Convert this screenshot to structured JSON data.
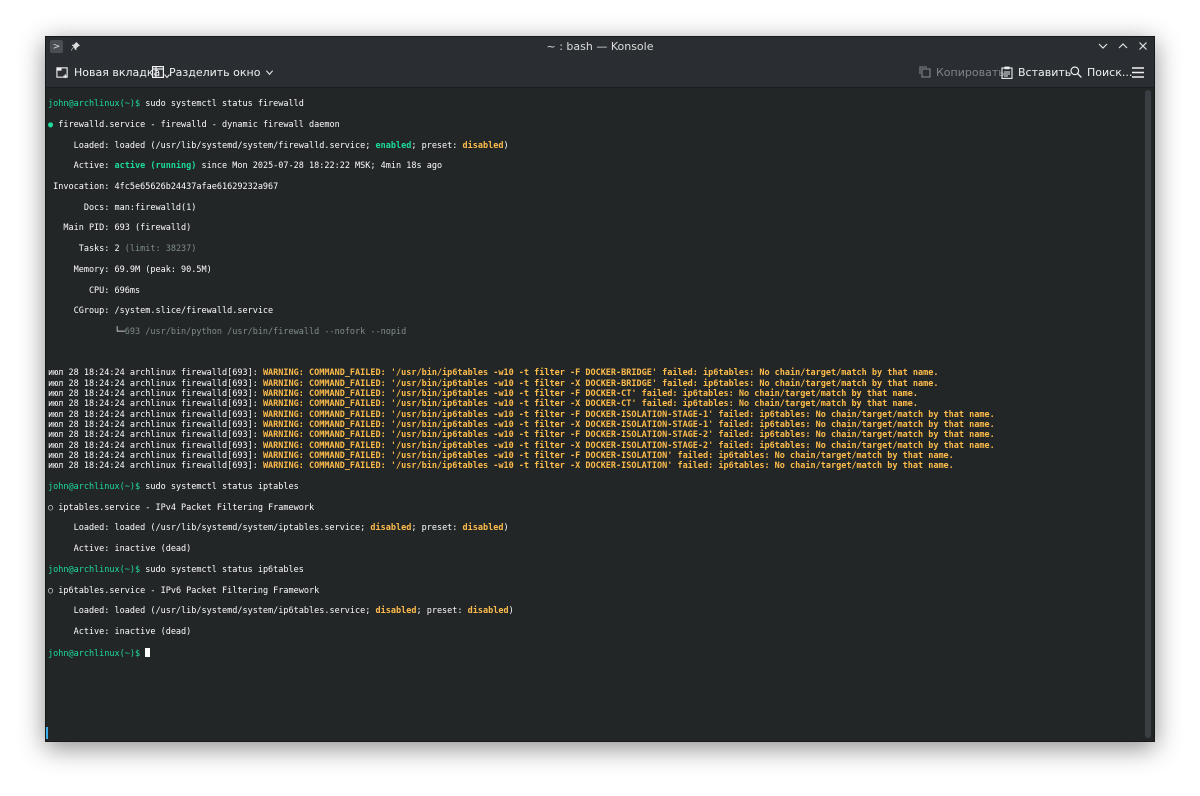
{
  "window": {
    "title": "~ : bash — Konsole"
  },
  "toolbar": {
    "new_tab": "Новая вкладка",
    "split_view": "Разделить окно",
    "copy": "Копировать",
    "paste": "Вставить",
    "search": "Поиск..."
  },
  "colors": {
    "background": "#232627",
    "prompt_green": "#1cdc9a",
    "warning_yellow": "#fdbc4b",
    "dim_gray": "#7f8c8d"
  },
  "terminal": {
    "prompt": "john@archlinux(~)$",
    "cmd1": " sudo systemctl status firewalld",
    "fw_bullet": "●",
    "fw_header": " firewalld.service - firewalld - dynamic firewall daemon",
    "fw_loaded_a": "     Loaded: loaded (/usr/lib/systemd/system/firewalld.service; ",
    "fw_loaded_enabled": "enabled",
    "fw_loaded_b": "; preset: ",
    "fw_loaded_preset": "disabled",
    "fw_loaded_c": ")",
    "fw_active_a": "     Active: ",
    "fw_active_state": "active (running)",
    "fw_active_b": " since Mon 2025-07-28 18:22:22 MSK; 4min 18s ago",
    "fw_invocation": " Invocation: 4fc5e65626b24437afae61629232a967",
    "fw_docs": "       Docs: man:firewalld(1)",
    "fw_mainpid": "   Main PID: 693 (firewalld)",
    "fw_tasks_a": "      Tasks: 2 ",
    "fw_tasks_limit": "(limit: 38237)",
    "fw_memory": "     Memory: 69.9M (peak: 90.5M)",
    "fw_cpu": "        CPU: 696ms",
    "fw_cgroup": "     CGroup: /system.slice/firewalld.service",
    "fw_cgroup_tree": "             └─",
    "fw_cgroup_proc": "693 /usr/bin/python /usr/bin/firewalld --nofork --nopid",
    "log_prefix": "июл 28 18:24:24 archlinux firewalld[693]: ",
    "log_lines": [
      "WARNING: COMMAND_FAILED: '/usr/bin/ip6tables -w10 -t filter -F DOCKER-BRIDGE' failed: ip6tables: No chain/target/match by that name.",
      "WARNING: COMMAND_FAILED: '/usr/bin/ip6tables -w10 -t filter -X DOCKER-BRIDGE' failed: ip6tables: No chain/target/match by that name.",
      "WARNING: COMMAND_FAILED: '/usr/bin/ip6tables -w10 -t filter -F DOCKER-CT' failed: ip6tables: No chain/target/match by that name.",
      "WARNING: COMMAND_FAILED: '/usr/bin/ip6tables -w10 -t filter -X DOCKER-CT' failed: ip6tables: No chain/target/match by that name.",
      "WARNING: COMMAND_FAILED: '/usr/bin/ip6tables -w10 -t filter -F DOCKER-ISOLATION-STAGE-1' failed: ip6tables: No chain/target/match by that name.",
      "WARNING: COMMAND_FAILED: '/usr/bin/ip6tables -w10 -t filter -X DOCKER-ISOLATION-STAGE-1' failed: ip6tables: No chain/target/match by that name.",
      "WARNING: COMMAND_FAILED: '/usr/bin/ip6tables -w10 -t filter -F DOCKER-ISOLATION-STAGE-2' failed: ip6tables: No chain/target/match by that name.",
      "WARNING: COMMAND_FAILED: '/usr/bin/ip6tables -w10 -t filter -X DOCKER-ISOLATION-STAGE-2' failed: ip6tables: No chain/target/match by that name.",
      "WARNING: COMMAND_FAILED: '/usr/bin/ip6tables -w10 -t filter -F DOCKER-ISOLATION' failed: ip6tables: No chain/target/match by that name.",
      "WARNING: COMMAND_FAILED: '/usr/bin/ip6tables -w10 -t filter -X DOCKER-ISOLATION' failed: ip6tables: No chain/target/match by that name."
    ],
    "cmd2": " sudo systemctl status iptables",
    "ipt_circle": "○",
    "ipt_header": " iptables.service - IPv4 Packet Filtering Framework",
    "ipt_loaded_a": "     Loaded: loaded (/usr/lib/systemd/system/iptables.service; ",
    "ipt_loaded_state": "disabled",
    "ipt_loaded_b": "; preset: ",
    "ipt_loaded_preset": "disabled",
    "ipt_loaded_c": ")",
    "ipt_active": "     Active: inactive (dead)",
    "cmd3": " sudo systemctl status ip6tables",
    "ip6_circle": "○",
    "ip6_header": " ip6tables.service - IPv6 Packet Filtering Framework",
    "ip6_loaded_a": "     Loaded: loaded (/usr/lib/systemd/system/ip6tables.service; ",
    "ip6_loaded_state": "disabled",
    "ip6_loaded_b": "; preset: ",
    "ip6_loaded_preset": "disabled",
    "ip6_loaded_c": ")",
    "ip6_active": "     Active: inactive (dead)",
    "cmd4": " "
  }
}
